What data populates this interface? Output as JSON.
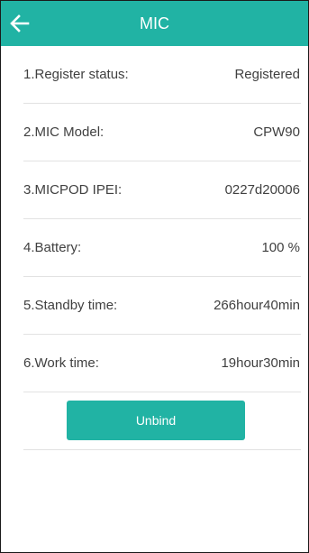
{
  "header": {
    "title": "MIC",
    "back_icon": "arrow-left-icon",
    "color": "#21b3a4"
  },
  "rows": [
    {
      "label": "1.Register status:",
      "value": "Registered"
    },
    {
      "label": "2.MIC Model:",
      "value": "CPW90"
    },
    {
      "label": "3.MICPOD IPEI:",
      "value": "0227d20006"
    },
    {
      "label": "4.Battery:",
      "value": "100 %"
    },
    {
      "label": "5.Standby time:",
      "value": "266hour40min"
    },
    {
      "label": "6.Work time:",
      "value": "19hour30min"
    }
  ],
  "actions": {
    "unbind_label": "Unbind"
  }
}
